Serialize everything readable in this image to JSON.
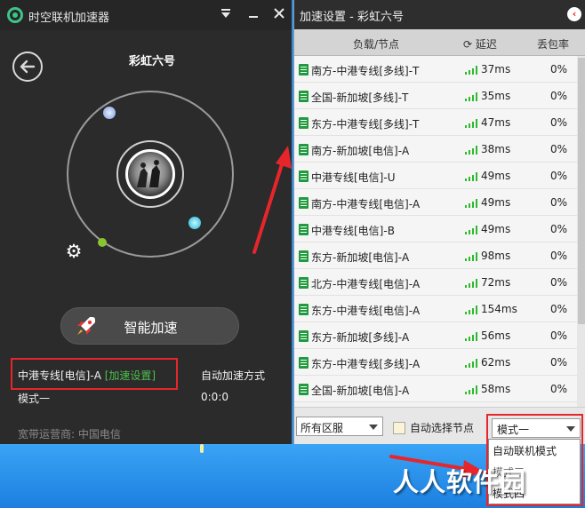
{
  "app": {
    "title": "时空联机加速器",
    "back_icon": "‹",
    "game_name": "彩虹六号",
    "boost_label": "智能加速",
    "current_node": "中港专线[电信]-A",
    "node_setting_link": "[加速设置]",
    "mode_label": "模式一",
    "auto_mode_label": "自动加速方式",
    "elapsed": "0:0:0",
    "isp_label": "宽带运营商: 中国电信",
    "colors": {
      "accent": "#3dc48a",
      "green_link": "#4cc04c",
      "highlight": "#e6262a"
    }
  },
  "panel": {
    "title": "加速设置 - 彩虹六号",
    "back_icon": "‹",
    "headers": {
      "node": "负载/节点",
      "ping": "延迟",
      "loss": "丢包率"
    },
    "rows": [
      {
        "name": "南方-中港专线[多线]-T",
        "ping": "37ms",
        "loss": "0%"
      },
      {
        "name": "全国-新加坡[多线]-T",
        "ping": "35ms",
        "loss": "0%"
      },
      {
        "name": "东方-中港专线[多线]-T",
        "ping": "47ms",
        "loss": "0%"
      },
      {
        "name": "南方-新加坡[电信]-A",
        "ping": "38ms",
        "loss": "0%"
      },
      {
        "name": "中港专线[电信]-U",
        "ping": "49ms",
        "loss": "0%"
      },
      {
        "name": "南方-中港专线[电信]-A",
        "ping": "49ms",
        "loss": "0%"
      },
      {
        "name": "中港专线[电信]-B",
        "ping": "49ms",
        "loss": "0%"
      },
      {
        "name": "东方-新加坡[电信]-A",
        "ping": "98ms",
        "loss": "0%"
      },
      {
        "name": "北方-中港专线[电信]-A",
        "ping": "72ms",
        "loss": "0%"
      },
      {
        "name": "东方-中港专线[电信]-A",
        "ping": "154ms",
        "loss": "0%"
      },
      {
        "name": "东方-新加坡[多线]-A",
        "ping": "56ms",
        "loss": "0%"
      },
      {
        "name": "东方-中港专线[多线]-A",
        "ping": "62ms",
        "loss": "0%"
      },
      {
        "name": "全国-新加坡[电信]-A",
        "ping": "58ms",
        "loss": "0%"
      }
    ],
    "region_select": "所有区服",
    "auto_select_label": "自动选择节点",
    "mode_select": "模式一",
    "mode_options": [
      "自动联机模式",
      "模式三",
      "模式四"
    ]
  },
  "watermark": "人人软件园"
}
